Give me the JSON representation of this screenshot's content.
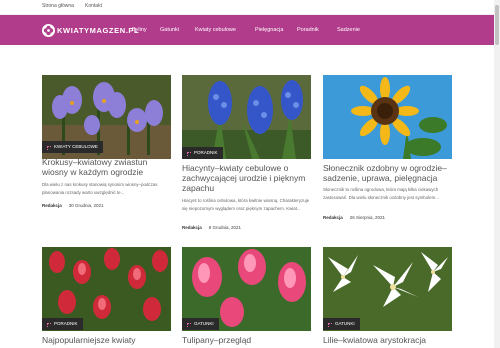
{
  "topbar": {
    "link_home": "Strona główna",
    "link_contact": "Kontakt"
  },
  "navbar": {
    "logo_text": "KWIATYMAGZEN.PL",
    "items": [
      "Byliny",
      "Gatunki",
      "Kwiaty cebulowe",
      "Pielęgnacja",
      "Poradnik",
      "Sadzenie"
    ]
  },
  "colors": {
    "brand": "#b23c8c",
    "badge_bg": "#2a2a2a"
  },
  "posts": [
    {
      "badge": "KWIATY CEBULOWE",
      "title": "Krokusy–kwiatowy zwiastun wiosny w każdym ogrodzie",
      "excerpt": "Dla wielu z nas krokusy stanowią synonim wiosny–podczas planowania rozsady warto uwzględnić te...",
      "author": "Redakcja",
      "date": "30 Grudnia, 2021"
    },
    {
      "badge": "PORADNIK",
      "title": "Hiacynty–kwiaty cebulowe o zachwycającej urodzie i pięknym zapachu",
      "excerpt": "Hiacynt to roślina cebulowa, która kwitnie wiosną. Charakteryzuje się niepozornym wyglądem oraz pięknym zapachem. Kwiat...",
      "author": "Redakcja",
      "date": "8 Grudnia, 2021"
    },
    {
      "badge": "",
      "title": "Słonecznik ozdobny w ogrodzie–sadzenie, uprawa, pielęgnacja",
      "excerpt": "Słonecznik to roślina ogrodowa, która mają kilka ciekawych zastosowań. Dla wielu słonecznik ozdobny jest symbolem...",
      "author": "Redakcja",
      "date": "26 Sierpnia, 2021"
    },
    {
      "badge": "PORADNIK",
      "title": "Najpopularniejsze kwiaty"
    },
    {
      "badge": "GATUNKI",
      "title": "Tulipany–przegląd"
    },
    {
      "badge": "GATUNKI",
      "title": "Lilie–kwiatowa arystokracja"
    }
  ]
}
